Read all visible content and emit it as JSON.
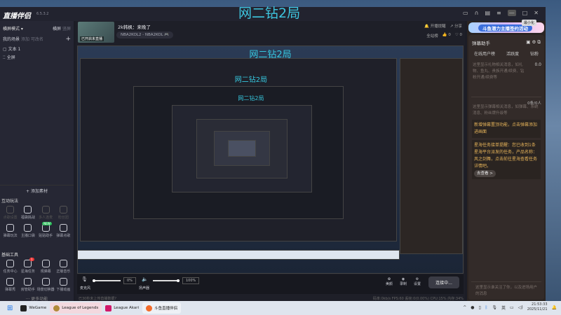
{
  "overlay_title": "网二钻2局",
  "app": {
    "name": "直播伴侣",
    "version": "6.5.3.2",
    "minimize_tooltip": "最小化"
  },
  "left": {
    "mode": "横屏模式 ▾",
    "mode_options": [
      "横屏",
      "竖屏"
    ],
    "scenes_label": "我的场景",
    "add": "添加",
    "rename": "可改名",
    "plus": "+",
    "sources": [
      "文本 1",
      "全屏"
    ],
    "add_source": "+ 添加素材",
    "interactive_title": "互动玩法",
    "interactive": [
      "点歌设置",
      "福袋挑战",
      "多人连麦",
      "粉丝团",
      "弹幕玩法",
      "主播口袋",
      "贴贴助手",
      "弹幕点歌"
    ],
    "interactive_new_badge": "NEW",
    "tools_title": "基础工具",
    "tools": [
      "任务中心",
      "星海任务",
      "观弹幕",
      "正版音乐",
      "弹幕秀",
      "房管助手",
      "场景切换器",
      "下播动画"
    ],
    "tools_badge": "1",
    "more": "··· 更多功能"
  },
  "main": {
    "thumb_label": "已开启未直播",
    "stream_title": "2k韩枫：来晚了",
    "tag": "NBA2KOL2 - NBA2KOL 🎮",
    "remind": "开播提醒",
    "share": "分享",
    "rank": "全站榜",
    "likes": "0",
    "hearts": "0",
    "mic_label": "麦克风",
    "mic_pct": "0%",
    "speaker_label": "扬声器",
    "speaker_pct": "100%",
    "mic_level": 0,
    "speaker_level": 100,
    "beauty": "美颜",
    "record": "录制",
    "settings": "设置",
    "connect": "连接中...",
    "status_left": "已30秒未上传直播数据?",
    "status_right": "码率:0kb/s  FPS:60  丢帧:0(0.00%)  CPU:15%  内存:34%"
  },
  "right": {
    "banner": "斗鱼潜力主播签约活动",
    "panel_title": "弹幕助手",
    "tabs": [
      "在线用户榜",
      "活跃度",
      "钻粉"
    ],
    "gift_hint": "这里显示礼物相关消息，如礼物、鱼丸、贵族开通/续费、钻粉开通/续费等",
    "gift_value": "0.0",
    "danmu_count": "0条/0人",
    "danmu_hint": "这里显示弹幕相关消息，如弹幕、系统消息、粉丝牌升级等",
    "notice1": "新增弹幕置顶功能，点击弹幕添加进画面",
    "notice2": "星海任务接单提醒：您已收到1条星海平台派发的任务，产品名称：风之剑舞，点击前往星海查看任务详情吧。",
    "go": "去查看 >",
    "follow_hint": "这里显示谁关注了你，以及进场用户的消息"
  },
  "taskbar": {
    "apps": [
      "WeGame",
      "League of Legends",
      "League Akari",
      "斗鱼直播伴侣"
    ],
    "ime": "英",
    "time": "21:53:33",
    "date": "2025/11/21"
  }
}
